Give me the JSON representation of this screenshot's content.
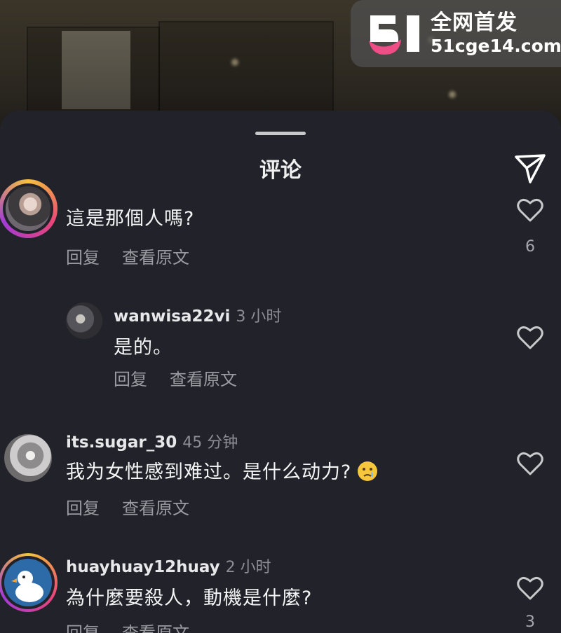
{
  "watermark": {
    "title": "全网首发",
    "url": "51cge14.com",
    "logo_text": "51"
  },
  "sheet": {
    "title": "评论"
  },
  "actions": {
    "reply": "回复",
    "view_original": "查看原文"
  },
  "comments": [
    {
      "username": "",
      "time": "",
      "text": "這是那個人嗎?",
      "likes": "6"
    },
    {
      "username": "wanwisa22vi",
      "time": "3 小时",
      "text": "是的。",
      "likes": ""
    },
    {
      "username": "its.sugar_30",
      "time": "45 分钟",
      "text": "我为女性感到难过。是什么动力?",
      "likes": ""
    },
    {
      "username": "huayhuay12huay",
      "time": "2 小时",
      "text": "為什麼要殺人，動機是什麼?",
      "likes": "3"
    }
  ],
  "colors": {
    "sheet_bg": "#22232a",
    "ring_gradient": [
      "#f6c33a",
      "#e8457a",
      "#a23bd6"
    ],
    "muted_text": "#9a9ba0"
  },
  "icons": {
    "share": "paper-plane-icon",
    "like": "heart-outline-icon",
    "emoji": "crying-face-emoji"
  }
}
